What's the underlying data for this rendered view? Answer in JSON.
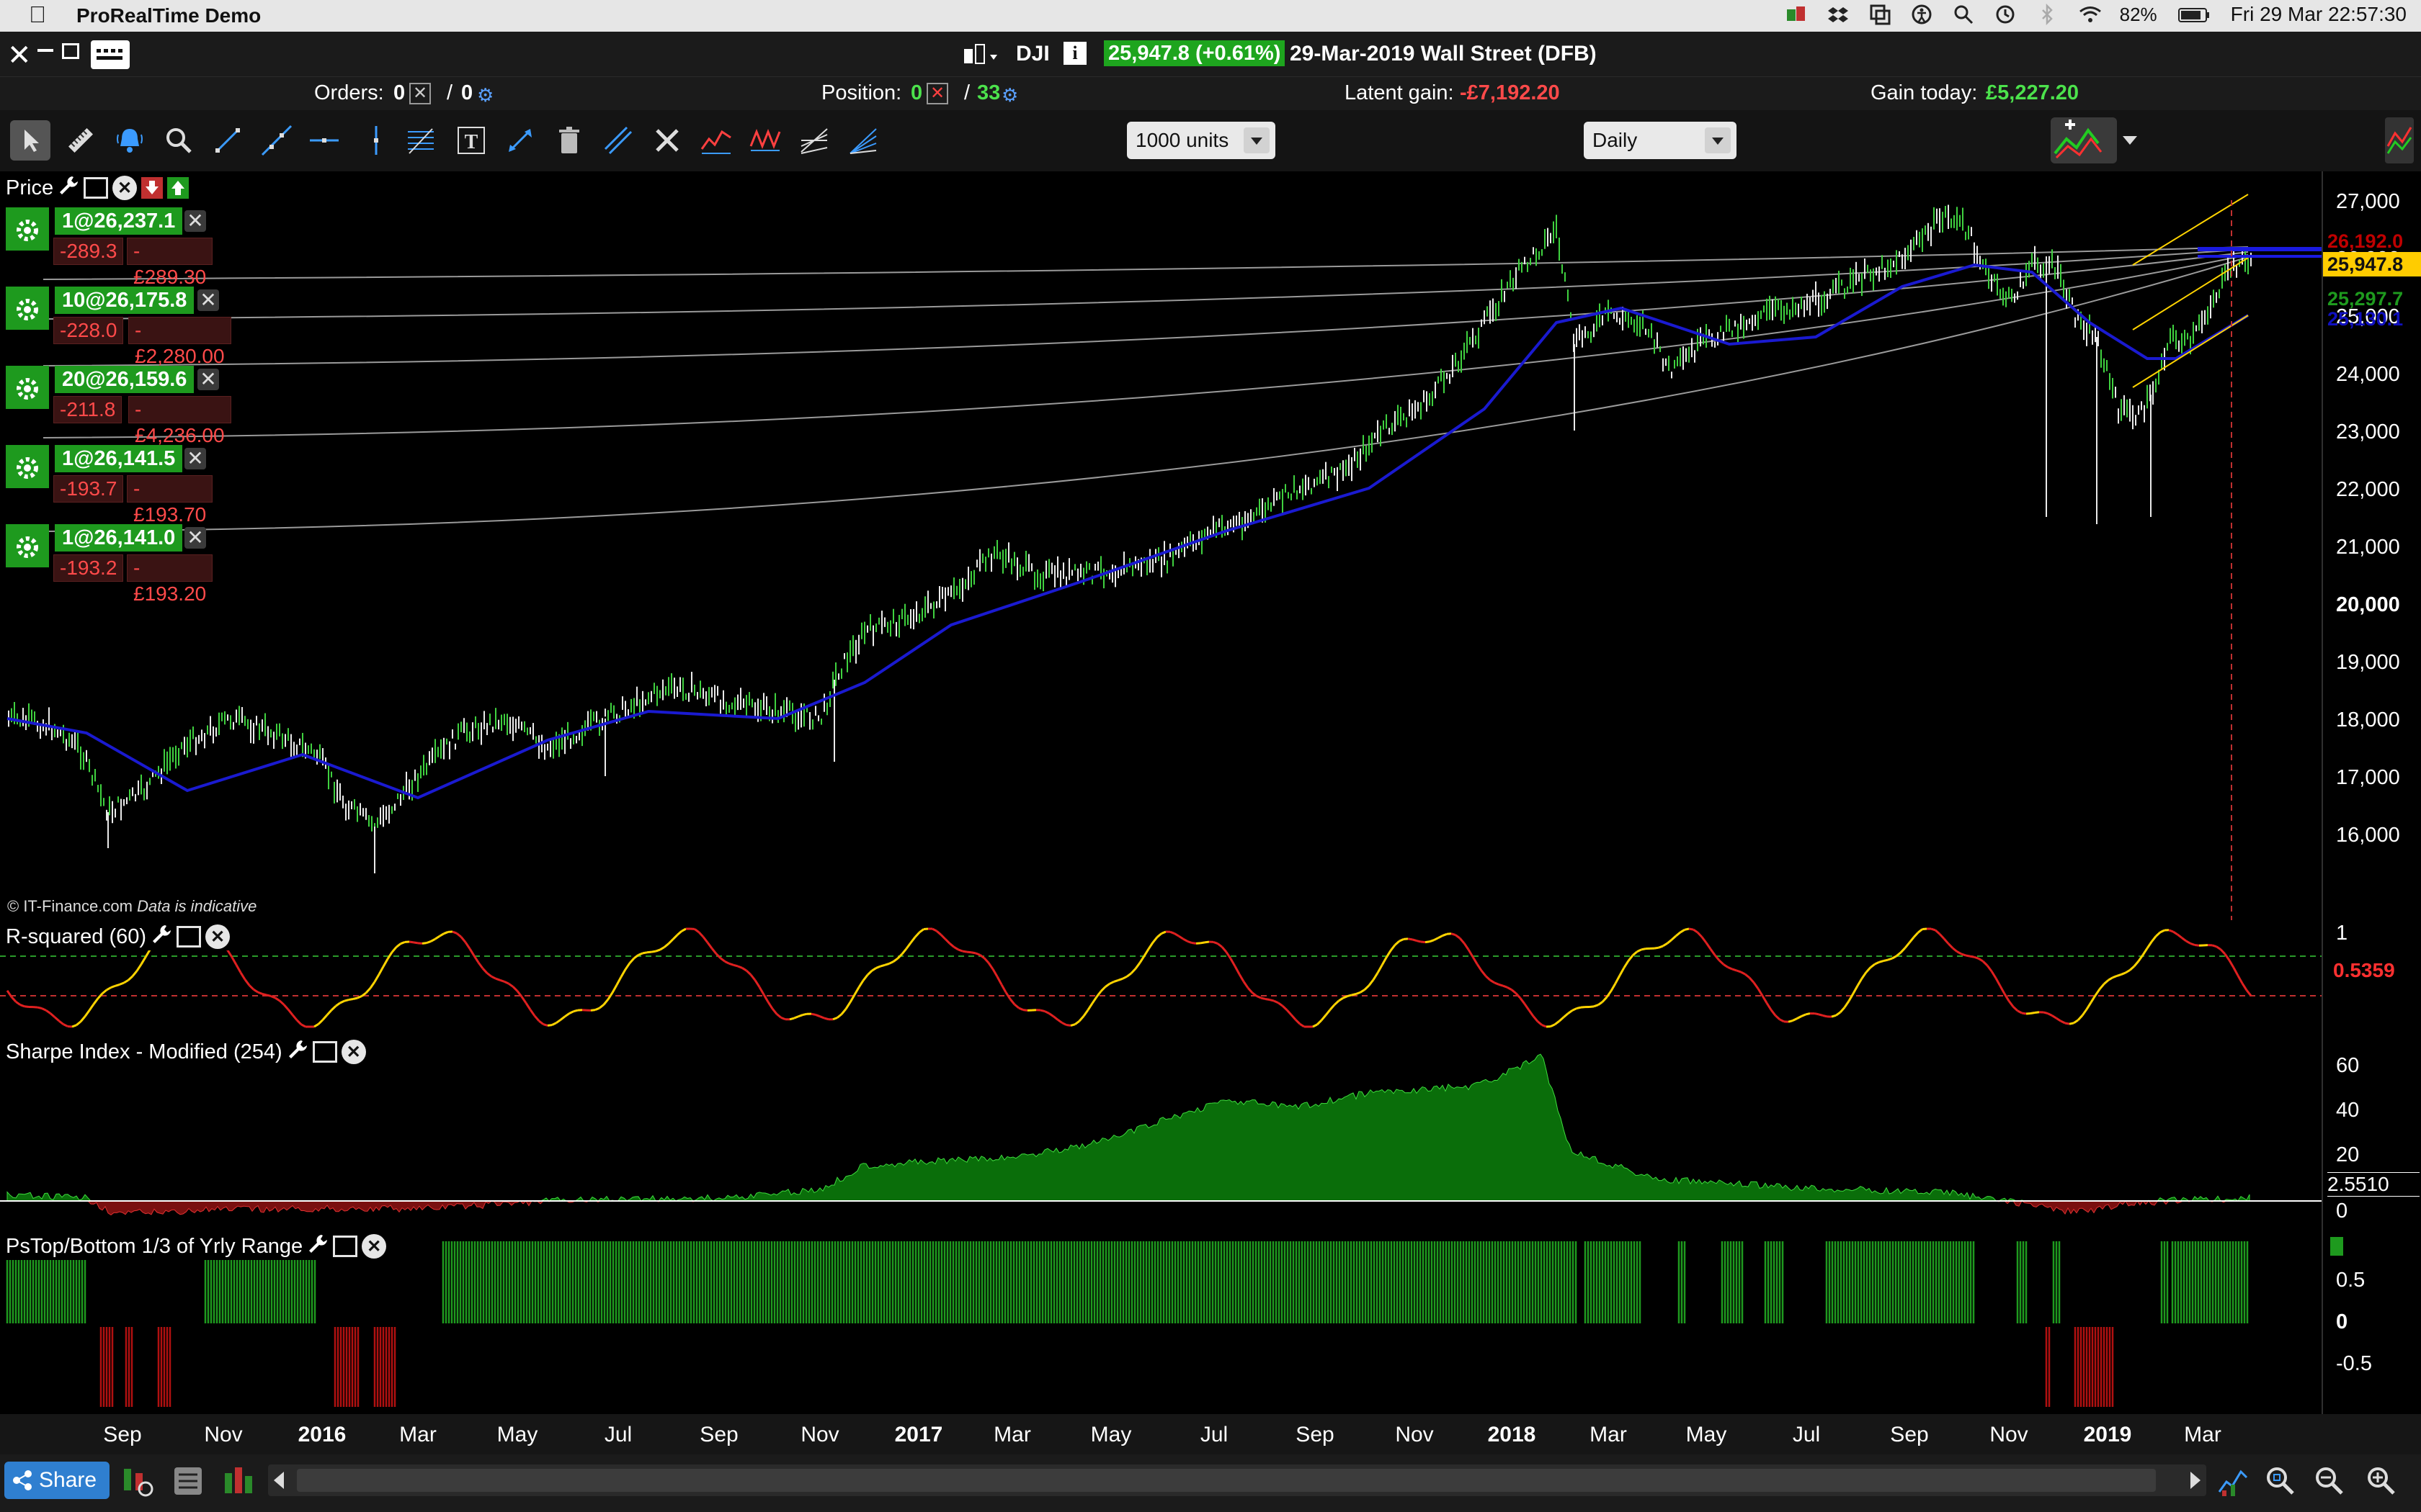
{
  "menubar": {
    "app_name": "ProRealTime Demo",
    "battery": "82%",
    "datetime": "Fri 29 Mar  22:57:30"
  },
  "titlebar": {
    "symbol": "DJI",
    "price": "25,947.8 (+0.61%)",
    "description": "29-Mar-2019 Wall Street (DFB)"
  },
  "status": {
    "orders_label": "Orders:",
    "orders_value1": "0",
    "orders_sep": "/",
    "orders_value2": "0",
    "position_label": "Position:",
    "position_value1": "0",
    "position_sep": "/",
    "position_value2": "33",
    "latent_label": "Latent gain:",
    "latent_value": "-£7,192.20",
    "gain_label": "Gain today:",
    "gain_value": "£5,227.20"
  },
  "toolbar": {
    "units": "1000 units",
    "timeframe": "Daily"
  },
  "price_panel": {
    "title": "Price",
    "credit": "© IT-Finance.com",
    "credit_note": "Data is indicative",
    "orders": [
      {
        "qty": "1@26,237.1",
        "pts": "-289.3",
        "gbp": "-£289.30"
      },
      {
        "qty": "10@26,175.8",
        "pts": "-228.0",
        "gbp": "-£2,280.00"
      },
      {
        "qty": "20@26,159.6",
        "pts": "-211.8",
        "gbp": "-£4,236.00"
      },
      {
        "qty": "1@26,141.5",
        "pts": "-193.7",
        "gbp": "-£193.70"
      },
      {
        "qty": "1@26,141.0",
        "pts": "-193.2",
        "gbp": "-£193.20"
      }
    ],
    "y_ticks": [
      "27,000",
      "26,000",
      "25,000",
      "24,000",
      "23,000",
      "22,000",
      "21,000",
      "20,000",
      "19,000",
      "18,000",
      "17,000",
      "16,000"
    ],
    "tags": [
      {
        "text": "26,192.0",
        "color": "#c00000"
      },
      {
        "text": "25,947.8",
        "color": "#ffcc00"
      },
      {
        "text": "25,297.7",
        "color": "#1e9a1e"
      },
      {
        "text": "25,130.1",
        "color": "#1010c0"
      }
    ]
  },
  "rsq_panel": {
    "title": "R-squared (60)",
    "axis_top": "1",
    "value": "0.5359"
  },
  "sharpe_panel": {
    "title": "Sharpe Index - Modified (254)",
    "y_ticks": [
      "60",
      "40",
      "20",
      "0"
    ],
    "value": "2.5510"
  },
  "pstop_panel": {
    "title": "PsTop/Bottom 1/3 of Yrly Range",
    "y_ticks": [
      "0.5",
      "0",
      "-0.5"
    ]
  },
  "x_axis": [
    {
      "label": "Sep",
      "bold": false
    },
    {
      "label": "Nov",
      "bold": false
    },
    {
      "label": "2016",
      "bold": true
    },
    {
      "label": "Mar",
      "bold": false
    },
    {
      "label": "May",
      "bold": false
    },
    {
      "label": "Jul",
      "bold": false
    },
    {
      "label": "Sep",
      "bold": false
    },
    {
      "label": "Nov",
      "bold": false
    },
    {
      "label": "2017",
      "bold": true
    },
    {
      "label": "Mar",
      "bold": false
    },
    {
      "label": "May",
      "bold": false
    },
    {
      "label": "Jul",
      "bold": false
    },
    {
      "label": "Sep",
      "bold": false
    },
    {
      "label": "Nov",
      "bold": false
    },
    {
      "label": "2018",
      "bold": true
    },
    {
      "label": "Mar",
      "bold": false
    },
    {
      "label": "May",
      "bold": false
    },
    {
      "label": "Jul",
      "bold": false
    },
    {
      "label": "Sep",
      "bold": false
    },
    {
      "label": "Nov",
      "bold": false
    },
    {
      "label": "2019",
      "bold": true
    },
    {
      "label": "Mar",
      "bold": false
    }
  ],
  "bottombar": {
    "share_label": "Share"
  }
}
